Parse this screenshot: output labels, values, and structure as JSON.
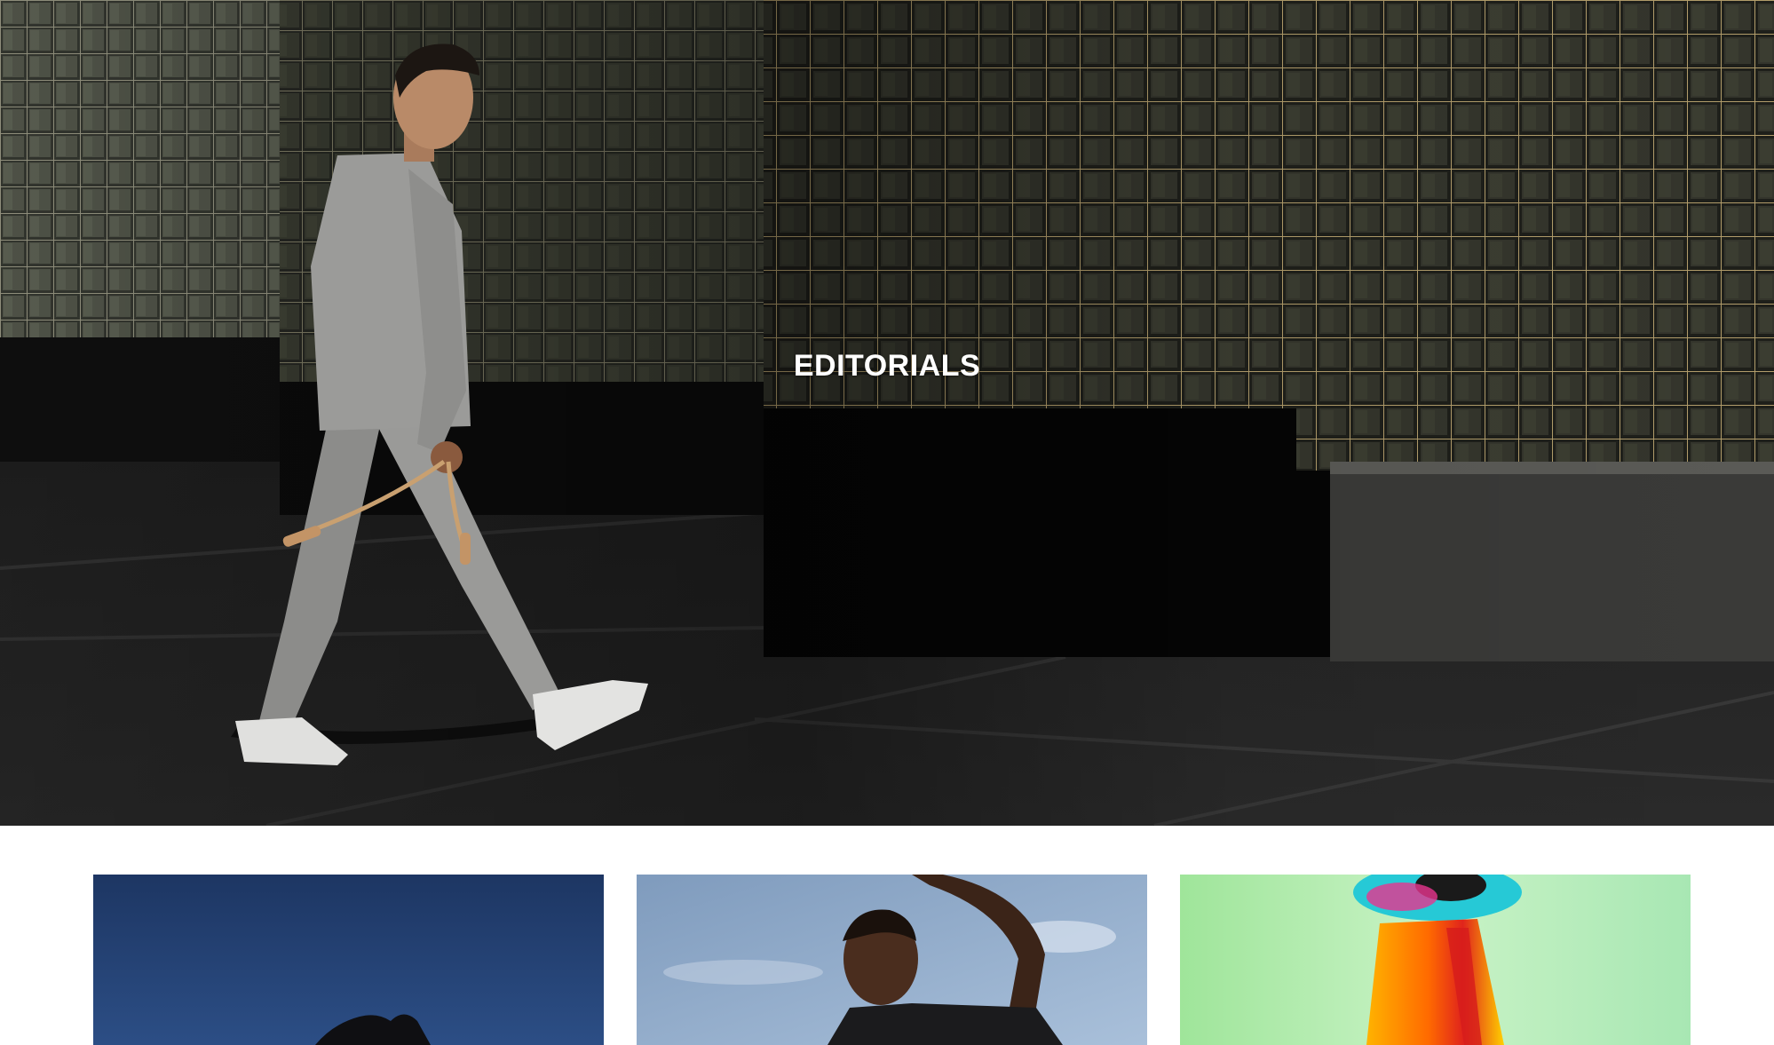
{
  "hero": {
    "title": "EDITORIALS",
    "image": "editorial-cover-photo"
  },
  "editorials": [
    {
      "image": "editorial-thumbnail-blue-sky"
    },
    {
      "image": "editorial-thumbnail-portrait-sky"
    },
    {
      "image": "editorial-thumbnail-colorful-fabric"
    }
  ],
  "colors": {
    "background": "#ffffff",
    "title_text": "#ffffff"
  }
}
